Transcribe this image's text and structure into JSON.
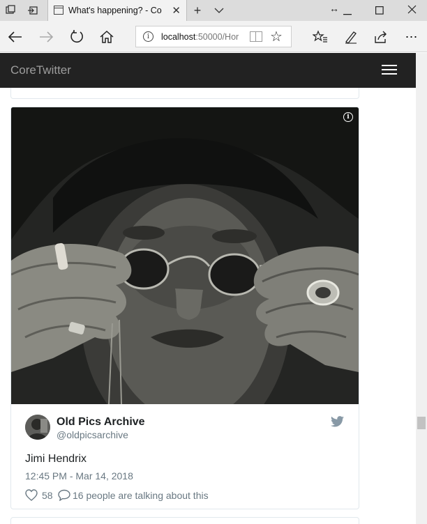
{
  "browser": {
    "tab_title": "What's happening? - Co",
    "url_host": "localhost",
    "url_rest": ":50000/Hor"
  },
  "navbar": {
    "brand": "CoreTwitter"
  },
  "tweet": {
    "author_name": "Old Pics Archive",
    "author_handle": "@oldpicsarchive",
    "text": "Jimi Hendrix",
    "timestamp": "12:45 PM - Mar 14, 2018",
    "like_count": "58",
    "talking": "16 people are talking about this"
  },
  "colors": {
    "navbar_bg": "#222222",
    "brand_text": "#9d9d9d",
    "meta_text": "#697882"
  }
}
